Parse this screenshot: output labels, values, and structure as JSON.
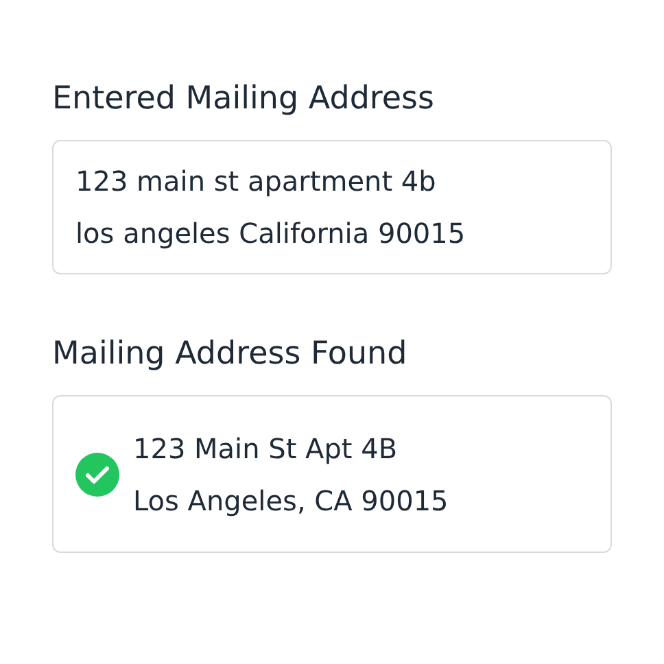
{
  "entered": {
    "heading": "Entered Mailing Address",
    "lines": [
      "123 main st apartment 4b",
      "los angeles California 90015"
    ]
  },
  "found": {
    "heading": "Mailing Address Found",
    "verified": true,
    "lines": [
      "123 Main St Apt 4B",
      "Los Angeles, CA 90015"
    ]
  }
}
